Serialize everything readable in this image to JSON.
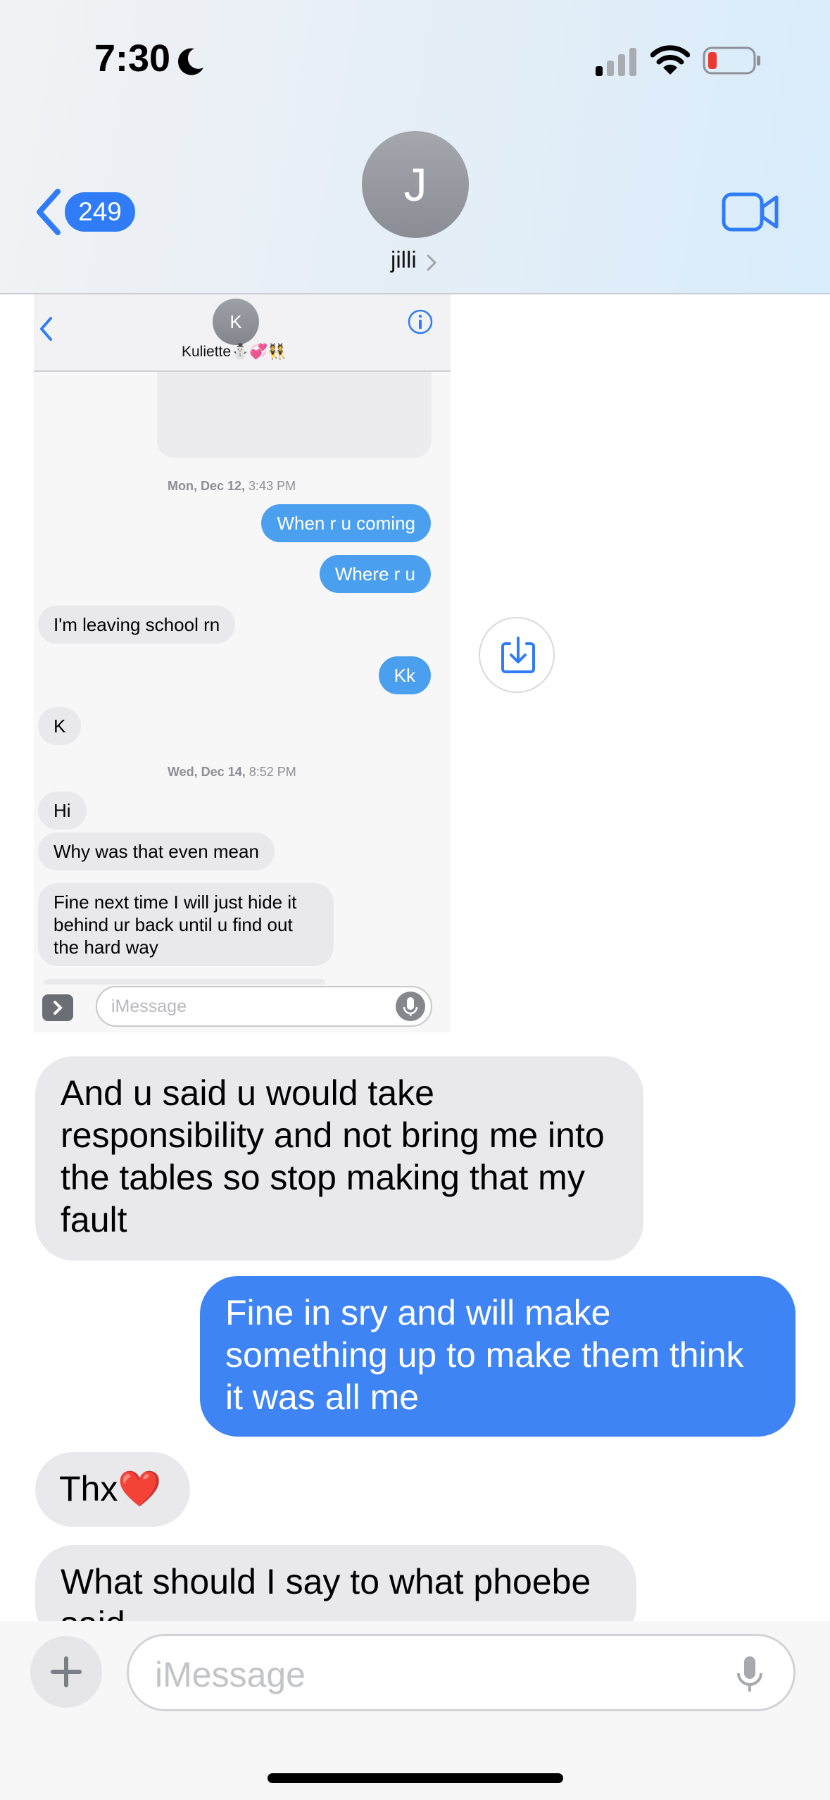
{
  "status_bar": {
    "time": "7:30"
  },
  "header": {
    "back_count": "249",
    "avatar_initial": "J",
    "contact_name": "jilli"
  },
  "embedded": {
    "avatar_initial": "K",
    "contact_name": "Kuliette⛄️💞👯",
    "messages": [
      {
        "type": "timestamp",
        "day": "Mon, Dec 12,",
        "time": "3:43 PM"
      },
      {
        "dir": "out",
        "text": "When r u coming"
      },
      {
        "dir": "out",
        "text": "Where r u"
      },
      {
        "dir": "in",
        "text": "I'm leaving school rn"
      },
      {
        "dir": "out",
        "text": "Kk"
      },
      {
        "dir": "in",
        "text": "K"
      },
      {
        "type": "timestamp",
        "day": "Wed, Dec 14,",
        "time": "8:52 PM"
      },
      {
        "dir": "in",
        "text": "Hi"
      },
      {
        "dir": "in",
        "text": "Why was that even mean"
      },
      {
        "dir": "in",
        "text": "Fine next time I will just hide it behind ur back until u find out the hard way"
      }
    ],
    "input_placeholder": "iMessage"
  },
  "conversation": [
    {
      "dir": "in",
      "text": "And u said u would take responsibility and not bring me into the tables so stop making that my fault"
    },
    {
      "dir": "out",
      "text": "Fine in sry and will make something up to make them think it was all me"
    },
    {
      "dir": "in",
      "text": "Thx❤️"
    },
    {
      "dir": "in",
      "text": "What should I say to what phoebe said"
    }
  ],
  "compose": {
    "placeholder": "iMessage"
  },
  "colors": {
    "outgoing": "#3e84f4",
    "incoming": "#e9e9eb",
    "accent": "#2f7cf6"
  },
  "icons": [
    "moon-icon",
    "cellular-signal-icon",
    "wifi-icon",
    "battery-icon",
    "back-chevron-icon",
    "video-camera-icon",
    "info-icon",
    "save-to-device-icon",
    "microphone-icon",
    "plus-icon"
  ]
}
